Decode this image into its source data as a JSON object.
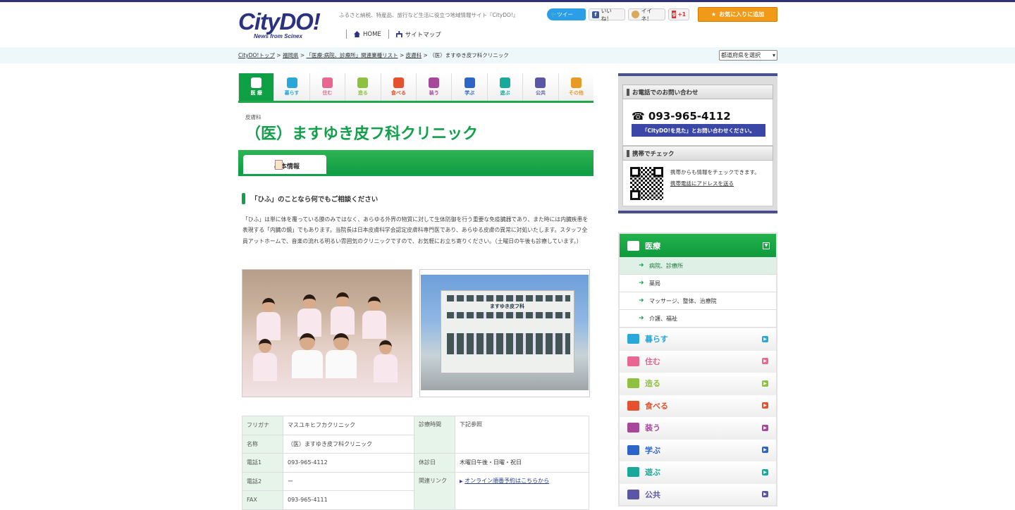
{
  "header": {
    "logo": "CityDO!",
    "logo_sub": "News from Scinex",
    "tagline": "ふるさと納税、特産品、旅行など生活に役立つ地域情報サイト『CityDO!』",
    "nav": [
      {
        "label": "HOME",
        "icon": "home-icon"
      },
      {
        "label": "サイトマップ",
        "icon": "sitemap-icon"
      }
    ],
    "social": {
      "tweet": "ツイー",
      "like": "いいね！",
      "mixi": "イイネ！",
      "gplus": "+1"
    },
    "favorite": "お気に入りに追加"
  },
  "breadcrumb": {
    "items": [
      "CityDO!トップ",
      "福岡県",
      "「医療:病院、診療所」関連業種リスト",
      "皮膚科"
    ],
    "current": "（医）ますゆき皮フ科クリニック",
    "separator": ">"
  },
  "pref_select": "都道府県を選択",
  "categories": [
    {
      "label": "医 療",
      "color": "#0fa046",
      "active": true
    },
    {
      "label": "暮らす",
      "color": "#2aa7d9"
    },
    {
      "label": "住む",
      "color": "#e8668f"
    },
    {
      "label": "造る",
      "color": "#8dc13f"
    },
    {
      "label": "食べる",
      "color": "#e3512e"
    },
    {
      "label": "装う",
      "color": "#a7479a"
    },
    {
      "label": "学ぶ",
      "color": "#2d64c7"
    },
    {
      "label": "遊ぶ",
      "color": "#19a99a"
    },
    {
      "label": "公共",
      "color": "#5a56a5"
    },
    {
      "label": "その他",
      "color": "#e79a24"
    }
  ],
  "page": {
    "category": "皮膚科",
    "title": "（医）ますゆき皮フ科クリニック",
    "tab": "基本情報",
    "heading": "「ひふ」のことなら何でもご相談ください",
    "description": "「ひふ」は単に体を覆っている膜のみではなく、あらゆる外界の物質に対して生体防御を行う重要な免疫臓器であり、また時には内臓疾患を表現する「内臓の鏡」でもあります。当院長は日本皮膚科学会認定皮膚科専門医であり、あらゆる皮膚の異常に対処いたします。スタッフ全員アットホームで、音楽の流れる明るい雰囲気のクリニックですので、お気軽にお立ち寄りください。（土曜日の午後も診療しています。）",
    "sign_text": "ますゆき皮フ科"
  },
  "info": {
    "left": [
      {
        "key": "フリガナ",
        "value": "マスユキヒフカクリニック"
      },
      {
        "key": "名称",
        "value": "（医）ますゆき皮フ科クリニック"
      },
      {
        "key": "電話1",
        "value": "093-965-4112"
      },
      {
        "key": "電話2",
        "value": "ー"
      },
      {
        "key": "FAX",
        "value": "093-965-4111"
      }
    ],
    "right": [
      {
        "key": "診療時間",
        "value": "下記参照"
      },
      {
        "key": "休診日",
        "value": "木曜日午後・日曜・祝日"
      },
      {
        "key": "関連リンク",
        "value": "オンライン順番予約はこちらから"
      }
    ]
  },
  "sidebar": {
    "contact_title": "お電話でのお問い合わせ",
    "phone": "☎ 093-965-4112",
    "phone_note": "「CityDO!を見た」とお問い合わせください。",
    "mobile_title": "携帯でチェック",
    "mobile_text": "携帯からも情報をチェックできます。",
    "mobile_link": "携帯電話にアドレスを送る",
    "menu": {
      "head": "医療",
      "subs": [
        "病院、診療所",
        "薬局",
        "マッサージ、整体、治療院",
        "介護、福祉"
      ],
      "rows": [
        {
          "label": "暮らす",
          "color": "#2aa7d9"
        },
        {
          "label": "住む",
          "color": "#e8668f"
        },
        {
          "label": "造る",
          "color": "#8dc13f"
        },
        {
          "label": "食べる",
          "color": "#e3512e"
        },
        {
          "label": "装う",
          "color": "#a7479a"
        },
        {
          "label": "学ぶ",
          "color": "#2d64c7"
        },
        {
          "label": "遊ぶ",
          "color": "#19a99a"
        },
        {
          "label": "公共",
          "color": "#5a56a5"
        }
      ]
    }
  }
}
